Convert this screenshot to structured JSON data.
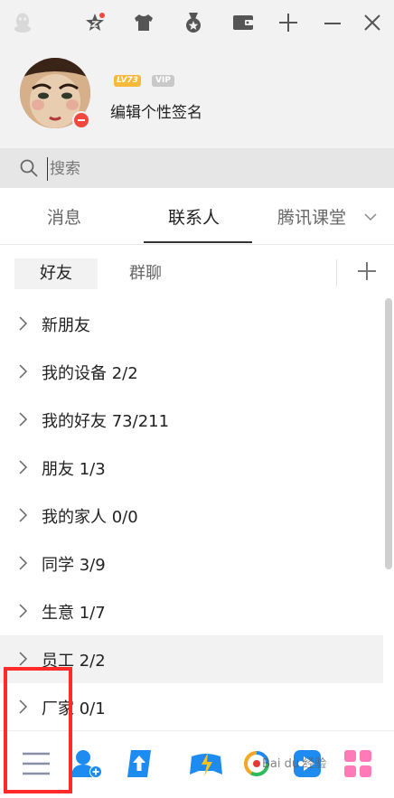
{
  "profile": {
    "level_badge": "LV73",
    "vip_badge": "VIP",
    "signature": "编辑个性签名"
  },
  "search": {
    "placeholder": "搜索"
  },
  "main_tabs": [
    {
      "label": "消息",
      "active": false
    },
    {
      "label": "联系人",
      "active": true
    },
    {
      "label": "腾讯课堂",
      "active": false
    }
  ],
  "sub_tabs": [
    {
      "label": "好友",
      "active": true
    },
    {
      "label": "群聊",
      "active": false
    }
  ],
  "groups": [
    {
      "label": "新朋友"
    },
    {
      "label": "我的设备 2/2"
    },
    {
      "label": "我的好友 73/211"
    },
    {
      "label": "朋友 1/3"
    },
    {
      "label": "我的家人 0/0"
    },
    {
      "label": "同学 3/9"
    },
    {
      "label": "生意 1/7"
    },
    {
      "label": "员工 2/2"
    },
    {
      "label": "厂家 0/1"
    }
  ],
  "bottom_bar": [
    "menu-icon",
    "add-friend-icon",
    "upload-icon",
    "game-icon",
    "browser-icon",
    "video-icon",
    "app-grid-icon"
  ],
  "watermark": "Bai du 经验",
  "colors": {
    "title_bar": "#f2f2f2",
    "search_bar": "#e6e6e6",
    "status_red": "#f0483e",
    "level_gold": "#f6b93b",
    "highlight_box": "#ff2b2b",
    "app_blue": "#1e8bf0"
  }
}
